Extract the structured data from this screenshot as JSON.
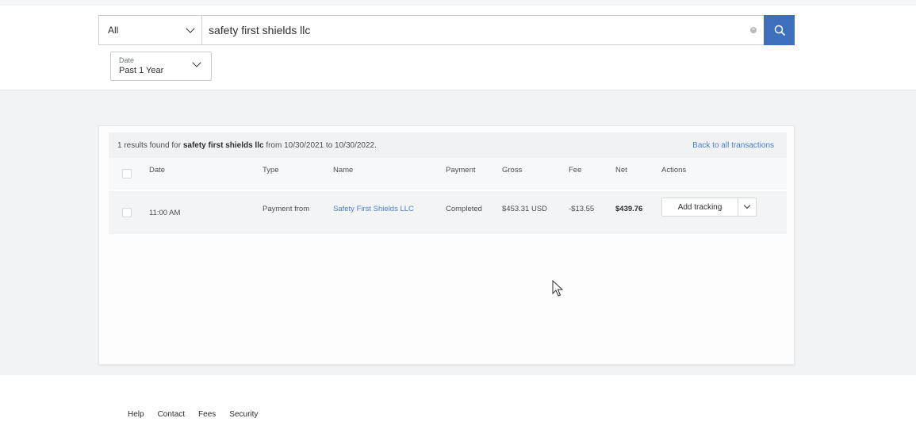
{
  "search": {
    "scope": "All",
    "query": "safety first shields llc",
    "clear_icon": "clear-icon",
    "search_icon": "search-icon",
    "accent": "#3e6fbd"
  },
  "date_filter": {
    "label": "Date",
    "value": "Past 1 Year"
  },
  "results": {
    "prefix": "1 results found for ",
    "term": "safety first shields llc",
    "suffix": " from 10/30/2021 to 10/30/2022.",
    "back_link": "Back to all transactions"
  },
  "table": {
    "columns": [
      "Date",
      "Type",
      "Name",
      "Payment",
      "Gross",
      "Fee",
      "Net",
      "Actions"
    ],
    "rows": [
      {
        "time": "11:00 AM",
        "type": "Payment from",
        "name": "Safety First Shields LLC",
        "payment": "Completed",
        "gross": "$453.31 USD",
        "fee": "-$13.55",
        "net": "$439.76",
        "action": "Add tracking"
      }
    ]
  },
  "footer": {
    "links": [
      "Help",
      "Contact",
      "Fees",
      "Security"
    ]
  },
  "colors": {
    "link": "#4a7fd0",
    "page_bg": "#f2f3f4"
  }
}
